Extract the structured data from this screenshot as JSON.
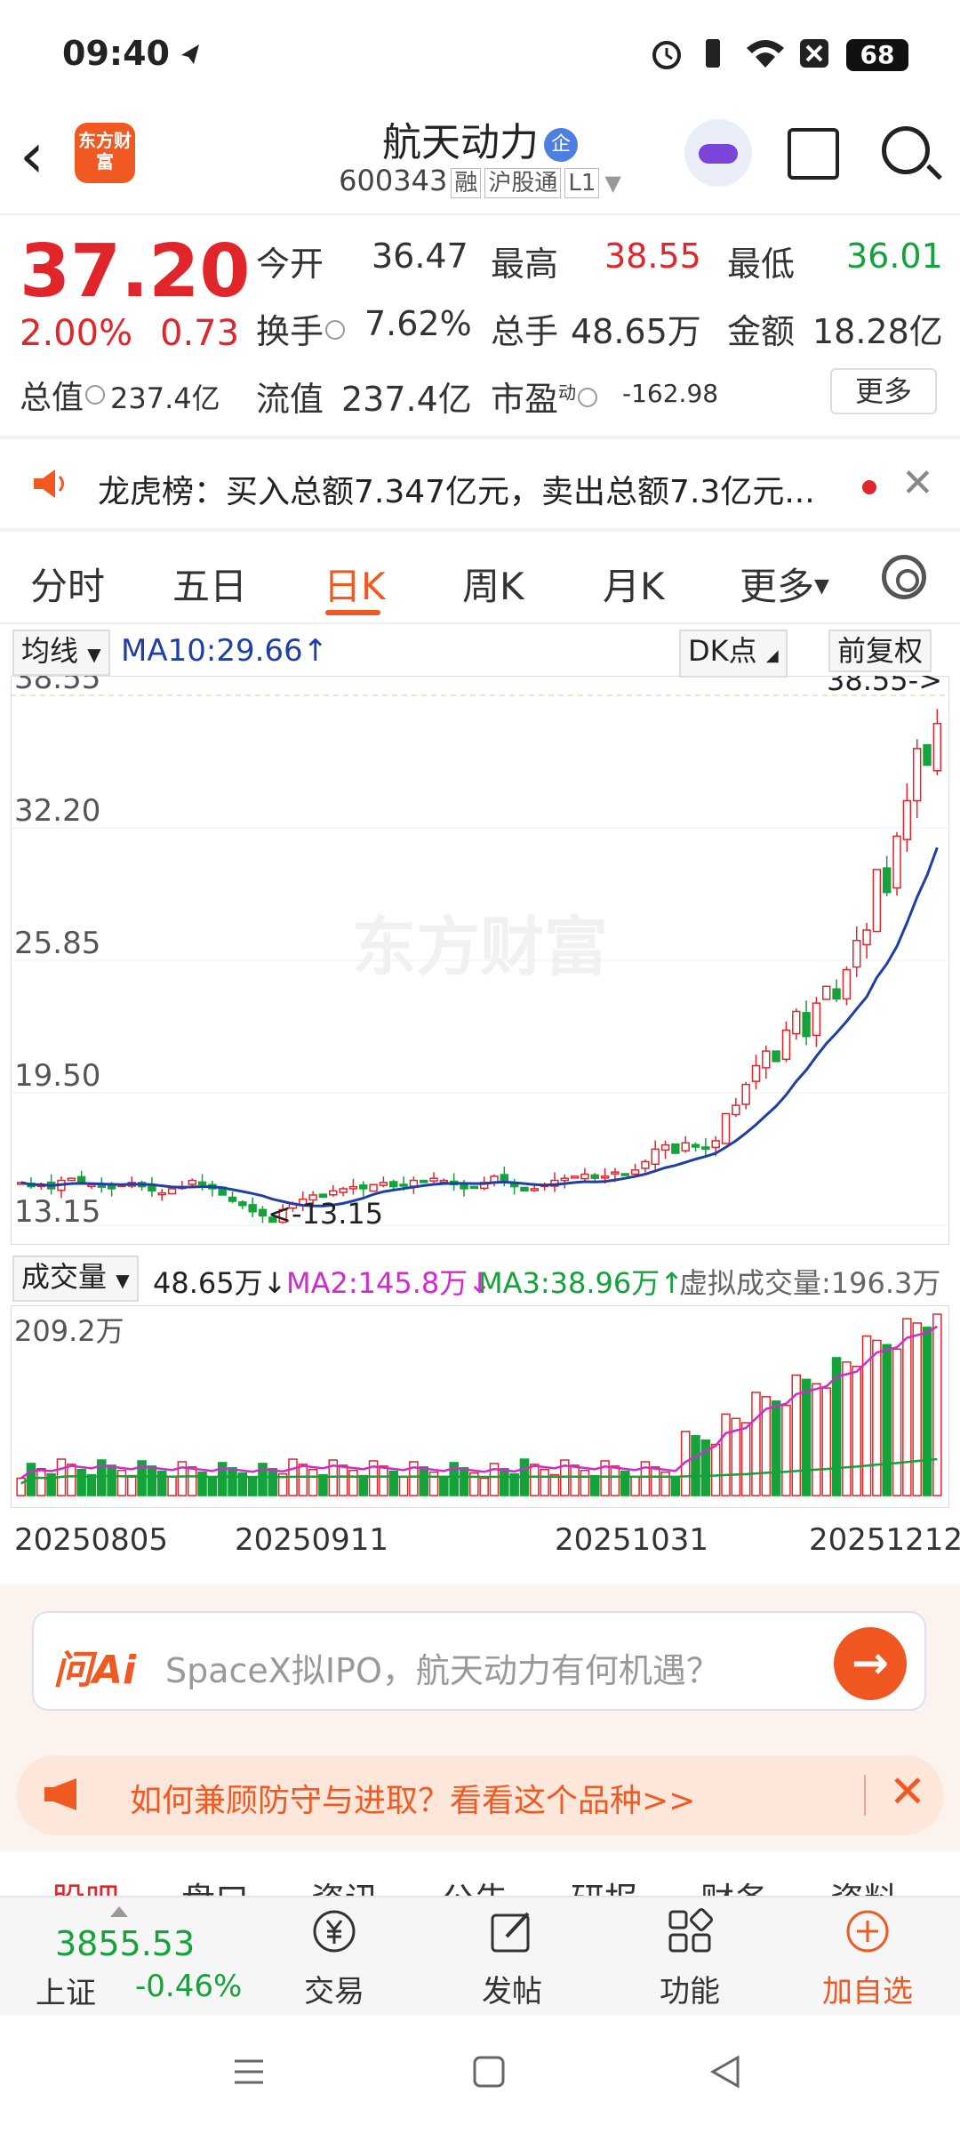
{
  "status_bar": {
    "time": "09:40",
    "battery": "68"
  },
  "header": {
    "logo_text": "东方财富",
    "stock_name": "航天动力",
    "enterprise_badge": "企",
    "stock_code": "600343",
    "tags": [
      "融",
      "沪股通",
      "L1"
    ]
  },
  "quote": {
    "price": "37.20",
    "change_pct": "2.00%",
    "change": "0.73",
    "open_label": "今开",
    "open": "36.47",
    "high_label": "最高",
    "high": "38.55",
    "low_label": "最低",
    "low": "36.01",
    "turnover_label": "换手",
    "turnover": "7.62%",
    "volume_label": "总手",
    "volume": "48.65万",
    "amount_label": "金额",
    "amount": "18.28亿",
    "mktcap_label": "总值",
    "mktcap": "237.4亿",
    "float_label": "流值",
    "float_cap": "237.4亿",
    "pe_label": "市盈",
    "pe_sup": "动",
    "pe": "-162.98",
    "more_button": "更多"
  },
  "notice": {
    "text": "龙虎榜：买入总额7.347亿元，卖出总额7.3亿元..."
  },
  "tabs": [
    "分时",
    "五日",
    "日K",
    "周K",
    "月K",
    "更多"
  ],
  "active_tab": "日K",
  "chart_controls": {
    "ma_select": "均线",
    "ma10": "MA10:29.66↑",
    "dk_points": "DK点",
    "adjust": "前复权",
    "vol_select": "成交量",
    "vol_value": "48.65万↓",
    "ma2": "MA2:145.8万↓",
    "ma3": "MA3:38.96万↑",
    "virtual_vol": "虚拟成交量:196.3万"
  },
  "chart_data": {
    "type": "candlestick",
    "y_ticks": [
      "38.55",
      "32.20",
      "25.85",
      "19.50",
      "13.15"
    ],
    "ylim": [
      13.15,
      38.55
    ],
    "high_marker": "38.55->",
    "low_marker": "<-13.15",
    "watermark": "东方财富",
    "x_labels": [
      "20250805",
      "20250911",
      "20251031",
      "20251212"
    ],
    "ma10_last": 29.66,
    "closes": [
      15.2,
      15.0,
      15.1,
      14.9,
      15.3,
      15.4,
      15.2,
      15.1,
      15.0,
      14.9,
      15.1,
      15.2,
      15.0,
      14.8,
      14.7,
      14.9,
      15.0,
      15.3,
      15.1,
      14.9,
      14.6,
      14.3,
      14.1,
      13.8,
      13.6,
      13.3,
      13.9,
      14.2,
      14.4,
      14.6,
      14.5,
      14.8,
      14.9,
      15.0,
      14.9,
      15.1,
      15.2,
      15.0,
      15.1,
      15.3,
      15.2,
      15.4,
      15.3,
      15.1,
      14.9,
      15.0,
      15.2,
      15.5,
      15.3,
      15.0,
      14.8,
      14.9,
      15.1,
      15.3,
      15.4,
      15.5,
      15.6,
      15.4,
      15.5,
      15.7,
      15.6,
      15.8,
      16.2,
      16.8,
      17.0,
      16.6,
      17.1,
      16.9,
      16.8,
      17.2,
      18.5,
      18.9,
      19.9,
      20.8,
      21.5,
      21.0,
      22.5,
      23.4,
      22.2,
      23.8,
      24.6,
      24.0,
      25.4,
      26.8,
      27.3,
      30.2,
      29.1,
      31.8,
      33.5,
      36.0,
      35.2,
      37.2
    ],
    "volume_ylabel": "209.2万",
    "volume_max": 209.2
  },
  "ai": {
    "logo": "问Ai",
    "placeholder": "SpaceX拟IPO，航天动力有何机遇？",
    "go": "→"
  },
  "promo": {
    "text": "如何兼顾防守与进取？看看这个品种>>"
  },
  "sub_tabs": [
    "股吧",
    "盘口",
    "资讯",
    "公告",
    "研报",
    "财务",
    "资料"
  ],
  "bottom_bar": {
    "index_value": "3855.53",
    "index_name": "上证",
    "index_pct": "-0.46%",
    "items": [
      "交易",
      "发帖",
      "功能",
      "加自选"
    ]
  }
}
